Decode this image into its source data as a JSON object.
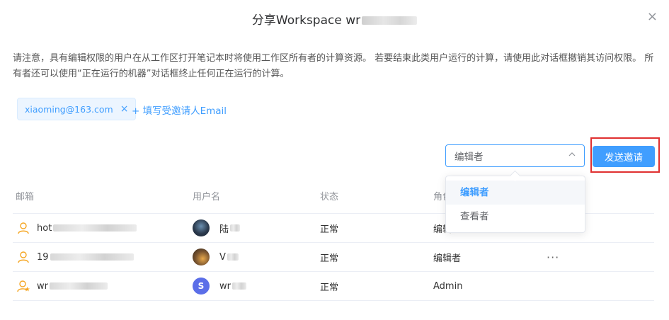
{
  "dialog": {
    "title": "分享Workspace wr",
    "close_label": "×"
  },
  "notice": "请注意，具有编辑权限的用户在从工作区打开笔记本时将使用工作区所有者的计算资源。 若要结束此类用户运行的计算，请使用此对话框撤销其访问权限。 所有者还可以使用“正在运行的机器”对话框终止任何正在运行的计算。",
  "invite": {
    "tag_email": "xiaoming@163.com",
    "tag_close": "×",
    "add_link": "+ 填写受邀请人Email",
    "role_value": "编辑者",
    "send_button": "发送邀请"
  },
  "dropdown": {
    "options": [
      "编辑者",
      "查看者"
    ],
    "selected": "编辑者"
  },
  "table": {
    "headers": {
      "email": "邮箱",
      "username": "用户名",
      "status": "状态",
      "role": "角色"
    },
    "rows": [
      {
        "email": "hot",
        "username": "陆",
        "status": "正常",
        "role": "编辑",
        "actions": ""
      },
      {
        "email": "19",
        "username": "V",
        "status": "正常",
        "role": "编辑者",
        "actions": "···"
      },
      {
        "email": "wr",
        "username": "wr",
        "status": "正常",
        "role": "Admin",
        "actions": ""
      }
    ],
    "avatar3_letter": "S"
  },
  "colors": {
    "primary": "#409eff",
    "highlight_border": "#e03030",
    "user_icon": "#f5a623"
  }
}
